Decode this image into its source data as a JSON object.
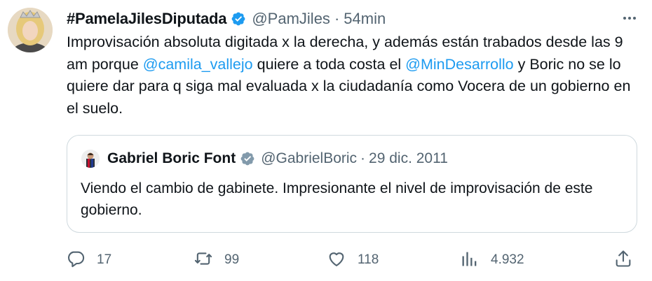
{
  "tweet": {
    "author_name": "#PamelaJilesDiputada",
    "handle": "@PamJiles",
    "separator": "·",
    "time": "54min",
    "text_parts": [
      "Improvisación absoluta digitada x la derecha, y además están trabados desde las 9 am porque ",
      "@camila_vallejo",
      " quiere a toda costa el ",
      "@MinDesarrollo",
      " y Boric no se lo quiere dar para q siga mal evaluada x la ciudadanía como Vocera de un gobierno en el suelo."
    ]
  },
  "quote": {
    "author_name": "Gabriel Boric Font",
    "handle": "@GabrielBoric",
    "separator": "·",
    "date": "29 dic. 2011",
    "text": "Viendo el cambio de gabinete. Impresionante el nivel de improvisación de este gobierno."
  },
  "actions": {
    "replies": "17",
    "retweets": "99",
    "likes": "118",
    "views": "4.932"
  },
  "colors": {
    "link": "#1d9bf0",
    "verified": "#1d9bf0",
    "muted": "#536471",
    "border": "#cfd9de"
  },
  "icons": {
    "more": "more-icon",
    "verified": "verified-badge-icon",
    "reply": "reply-icon",
    "retweet": "retweet-icon",
    "like": "heart-icon",
    "views": "views-icon",
    "share": "share-icon"
  }
}
